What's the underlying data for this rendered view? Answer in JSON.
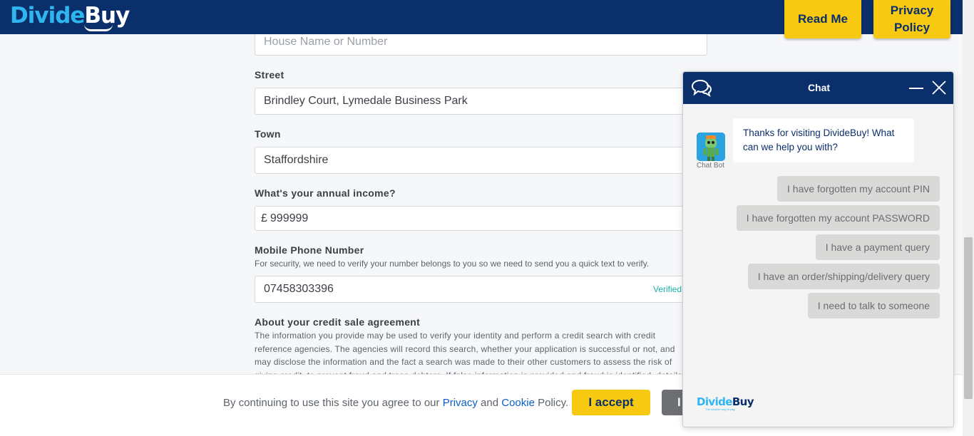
{
  "header": {
    "logo_divide": "Divide",
    "logo_buy": "Buy",
    "read_me": "Read Me",
    "privacy_policy": "Privacy Policy"
  },
  "form": {
    "house_placeholder": "House Name or Number",
    "street_label": "Street",
    "street_value": "Brindley Court, Lymedale Business Park",
    "town_label": "Town",
    "town_value": "Staffordshire",
    "income_label": "What's your annual income?",
    "income_currency": "£",
    "income_value": "999999",
    "mobile_label": "Mobile Phone Number",
    "mobile_helper": "For security, we need to verify your number belongs to you so we need to send you a quick text to verify.",
    "mobile_value": "07458303396",
    "mobile_status": "Verified",
    "agreement_label": "About your credit sale agreement",
    "agreement_text": "The information you provide may be used to verify your identity and perform a credit search with credit reference agencies. The agencies will record this search, whether your application is successful or not, and may disclose the information and the fact a search was made to their other customers to assess the risk of giving credit, to prevent fraud and trace debtors. If false information is provided and fraud is identified, details will be passed"
  },
  "cookie": {
    "text_before": "By continuing to use this site you agree to our ",
    "privacy_link": "Privacy",
    "text_and": " and ",
    "cookie_link": "Cookie",
    "text_after": " Policy.",
    "accept": "I accept",
    "second_button": "I"
  },
  "chat": {
    "title": "Chat",
    "bot_name": "Chat Bot",
    "greeting": "Thanks for visiting DivideBuy! What can we help you with?",
    "options": [
      "I have forgotten my account PIN",
      "I have forgotten my account PASSWORD",
      "I have a payment query",
      "I have an order/shipping/delivery query",
      "I need to talk to someone"
    ],
    "footer_logo_divide": "Divide",
    "footer_logo_buy": "Buy",
    "footer_tagline": "The smarter way to pay"
  },
  "colors": {
    "navy": "#0a2f6b",
    "yellow": "#f7c911",
    "cyan": "#2fb6f0",
    "verified": "#1cb0a8"
  }
}
